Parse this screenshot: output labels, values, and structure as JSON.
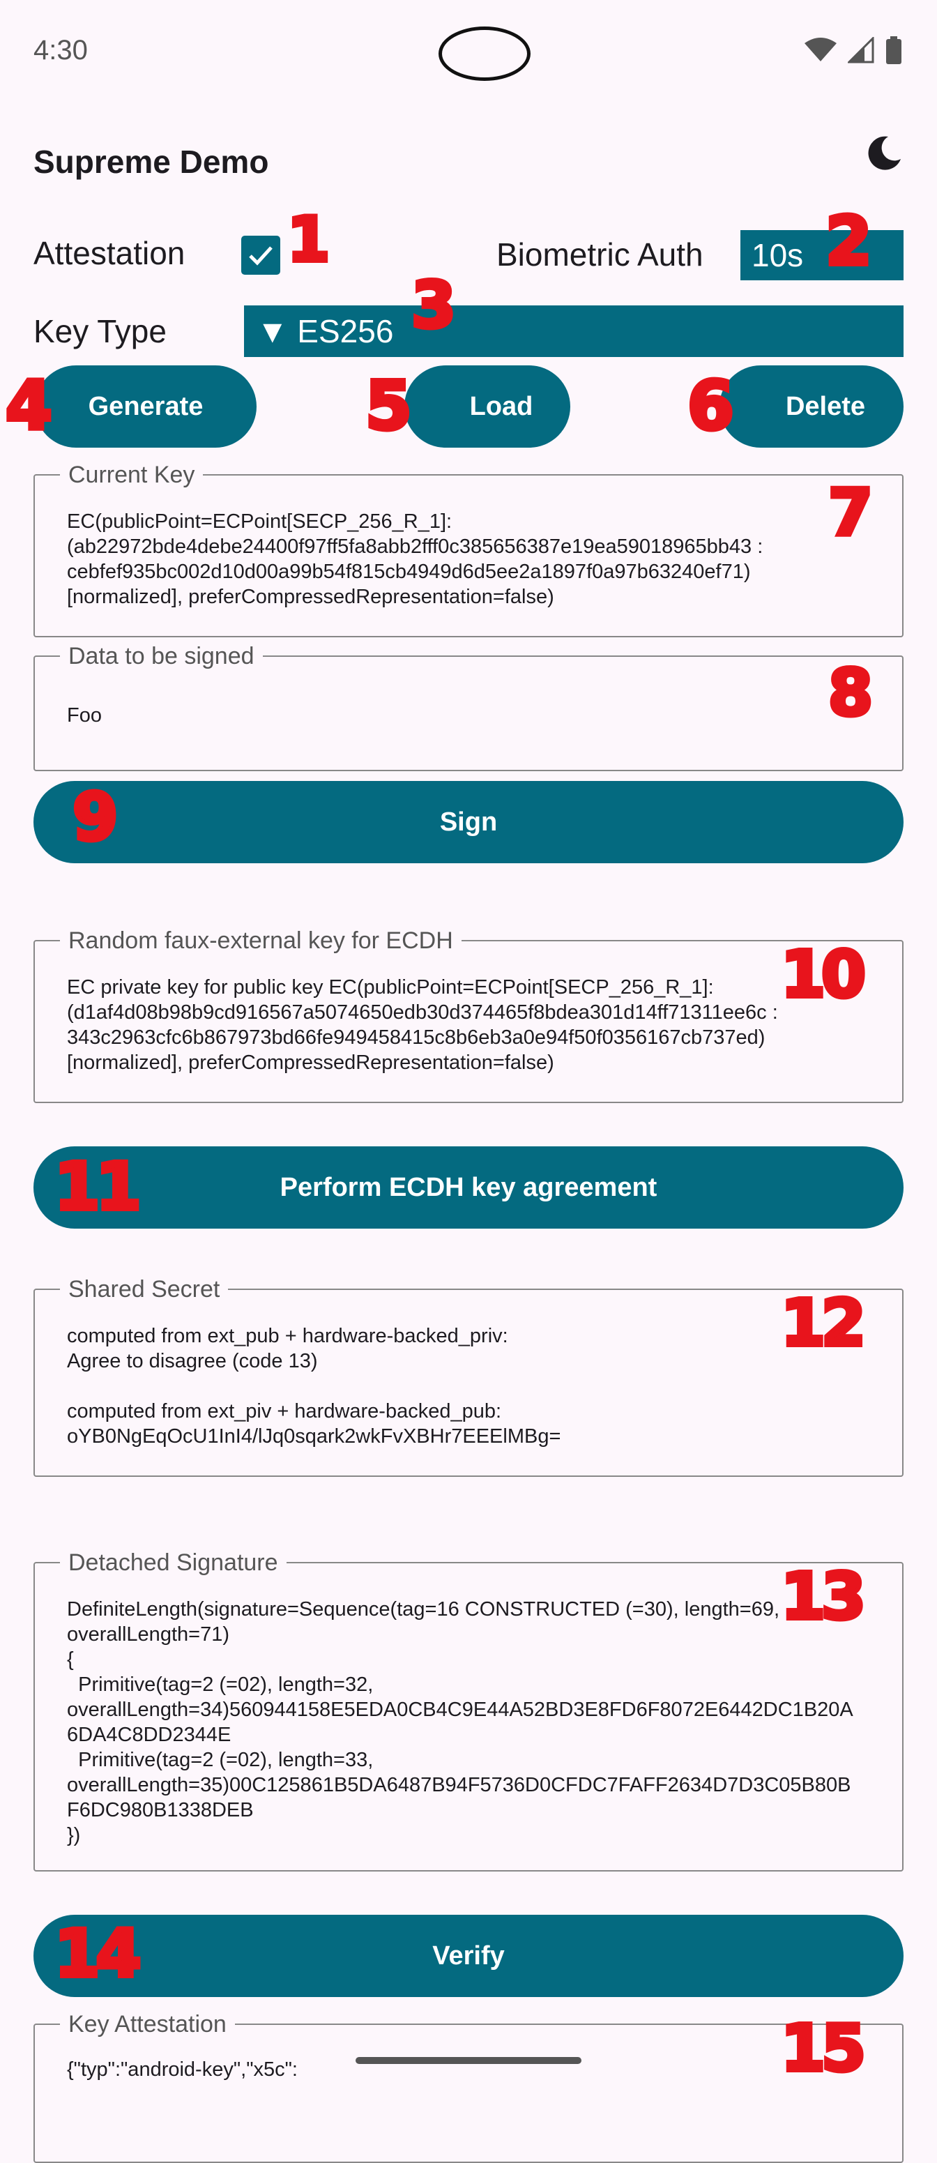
{
  "status_bar": {
    "time": "4:30"
  },
  "app": {
    "title": "Supreme Demo"
  },
  "controls": {
    "attestation_label": "Attestation",
    "attestation_checked": true,
    "biometric_label": "Biometric Auth",
    "biometric_value": "10s",
    "key_type_label": "Key Type",
    "key_type_value": "▼ ES256",
    "generate": "Generate",
    "load": "Load",
    "delete": "Delete",
    "sign": "Sign",
    "ecdh": "Perform ECDH key agreement",
    "verify": "Verify"
  },
  "fields": {
    "current_key": {
      "legend": "Current Key",
      "text": "EC(publicPoint=ECPoint[SECP_256_R_1]:\n(ab22972bde4debe24400f97ff5fa8abb2fff0c385656387e19ea59018965bb43 :\ncebfef935bc002d10d00a99b54f815cb4949d6d5ee2a1897f0a97b63240ef71)\n[normalized], preferCompressedRepresentation=false)"
    },
    "data_to_sign": {
      "legend": "Data to be signed",
      "text": "Foo"
    },
    "ecdh_key": {
      "legend": "Random faux-external key for ECDH",
      "text": "EC private key for public key EC(publicPoint=ECPoint[SECP_256_R_1]:\n(d1af4d08b98b9cd916567a5074650edb30d374465f8bdea301d14ff71311ee6c :\n343c2963cfc6b867973bd66fe949458415c8b6eb3a0e94f50f0356167cb737ed)\n[normalized], preferCompressedRepresentation=false)"
    },
    "shared_secret": {
      "legend": "Shared Secret",
      "text": "computed from ext_pub + hardware-backed_priv:\nAgree to disagree (code 13)\n\ncomputed from ext_piv + hardware-backed_pub:\noYB0NgEqOcU1InI4/lJq0sqark2wkFvXBHr7EEElMBg="
    },
    "detached_signature": {
      "legend": "Detached Signature",
      "text": "DefiniteLength(signature=Sequence(tag=16 CONSTRUCTED (=30), length=69,\noverallLength=71)\n{\n  Primitive(tag=2 (=02), length=32,\noverallLength=34)560944158E5EDA0CB4C9E44A52BD3E8FD6F8072E6442DC1B20A\n6DA4C8DD2344E\n  Primitive(tag=2 (=02), length=33,\noverallLength=35)00C125861B5DA6487B94F5736D0CFDC7FAFF2634D7D3C05B80B\nF6DC980B1338DEB\n})"
    },
    "key_attestation": {
      "legend": "Key Attestation",
      "text": "{\"typ\":\"android-key\",\"x5c\":"
    }
  },
  "annotations": [
    "1",
    "2",
    "3",
    "4",
    "5",
    "6",
    "7",
    "8",
    "9",
    "10",
    "11",
    "12",
    "13",
    "14",
    "15"
  ],
  "colors": {
    "primary": "#046a80",
    "annotation": "#e8141c",
    "background": "#fdf7fc"
  }
}
